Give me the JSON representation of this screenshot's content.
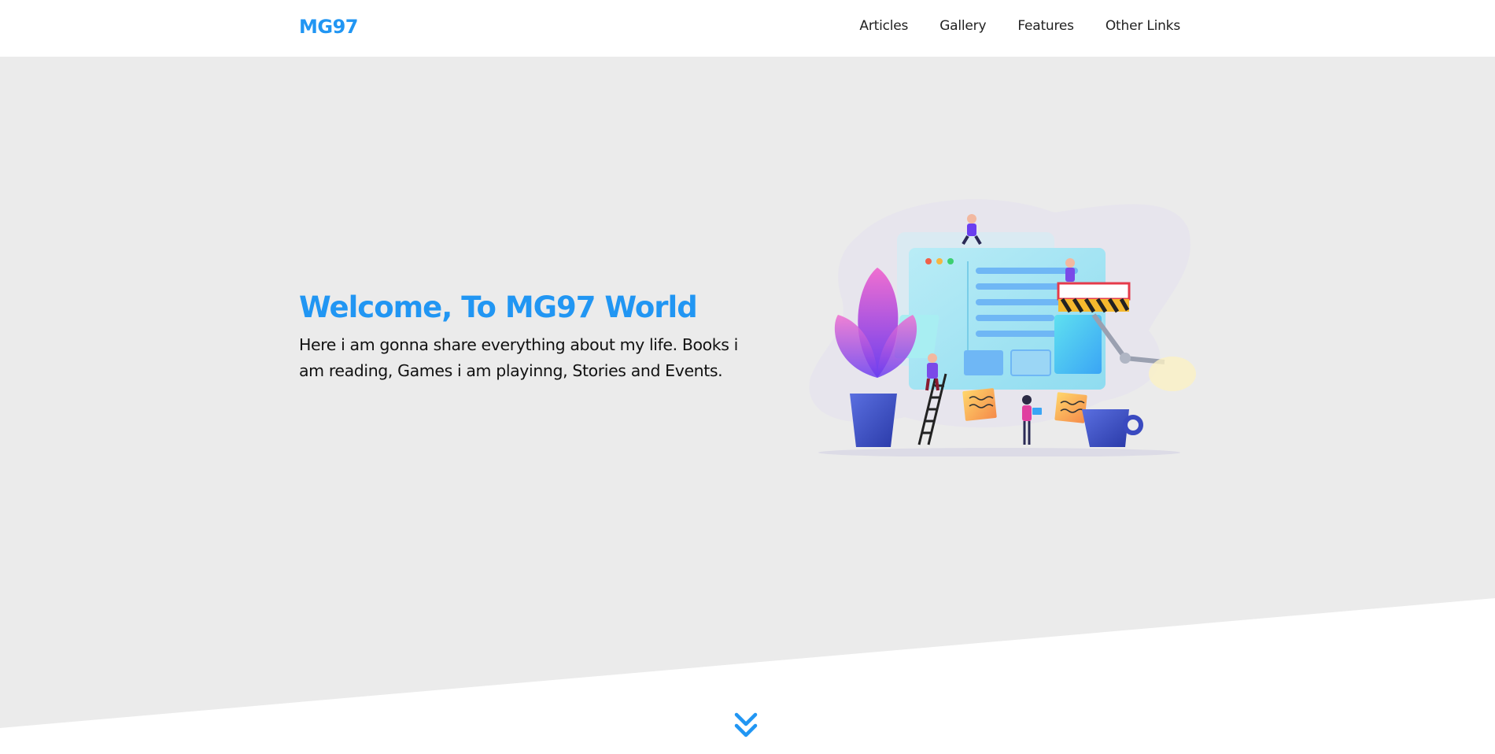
{
  "header": {
    "logo": "MG97",
    "nav": [
      {
        "label": "Articles"
      },
      {
        "label": "Gallery"
      },
      {
        "label": "Features"
      },
      {
        "label": "Other Links"
      }
    ]
  },
  "hero": {
    "title": "Welcome, To MG97 World",
    "description": "Here i am gonna share everything about my life. Books i am reading, Games i am playinng, Stories and Events."
  },
  "icons": {
    "scroll": "double-chevron-down-icon"
  },
  "colors": {
    "accent": "#2196f3",
    "hero_bg": "#ebebeb",
    "page_bg": "#ffffff"
  }
}
